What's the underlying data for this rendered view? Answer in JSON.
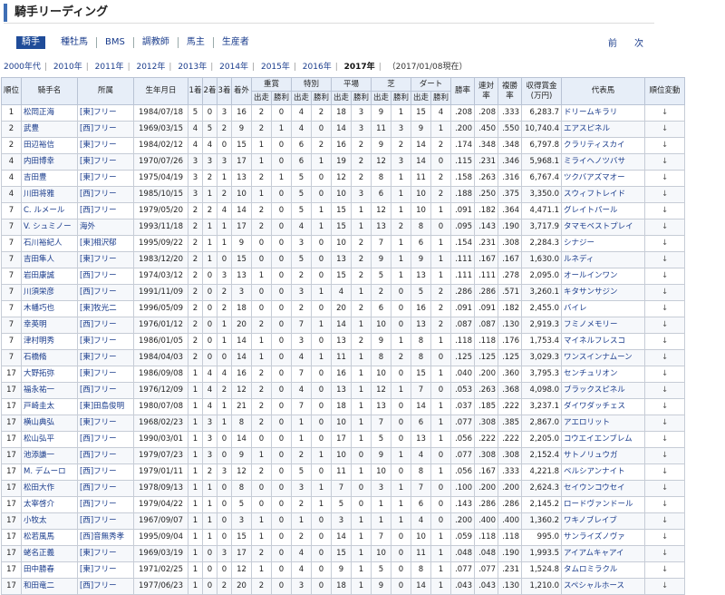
{
  "page_title": "騎手リーディング",
  "nav": {
    "active": "騎手",
    "items": [
      "種牡馬",
      "BMS",
      "調教師",
      "馬主",
      "生産者"
    ],
    "prev": "前",
    "next": "次"
  },
  "years": {
    "items": [
      "2000年代",
      "2010年",
      "2011年",
      "2012年",
      "2013年",
      "2014年",
      "2015年",
      "2016年"
    ],
    "current": "2017年",
    "current_note": "（2017/01/08現在）"
  },
  "table": {
    "headers_top": [
      "順位",
      "騎手名",
      "所属",
      "生年月日",
      "1着",
      "2着",
      "3着",
      "着外",
      "重賞",
      "特別",
      "平場",
      "芝",
      "ダート",
      "勝率",
      "連対率",
      "複勝率",
      "収得賞金(万円)",
      "代表馬",
      "順位変動"
    ],
    "headers_sub": [
      "出走",
      "勝利",
      "出走",
      "勝利",
      "出走",
      "勝利",
      "出走",
      "勝利",
      "出走",
      "勝利"
    ],
    "rows": [
      [
        "1",
        "松岡正海",
        "[東]フリー",
        "1984/07/18",
        "5",
        "0",
        "3",
        "16",
        "2",
        "0",
        "4",
        "2",
        "18",
        "3",
        "9",
        "1",
        "15",
        "4",
        ".208",
        ".208",
        ".333",
        "6,283.7",
        "ドリームキラリ",
        "↓"
      ],
      [
        "2",
        "武豊",
        "[西]フリー",
        "1969/03/15",
        "4",
        "5",
        "2",
        "9",
        "2",
        "1",
        "4",
        "0",
        "14",
        "3",
        "11",
        "3",
        "9",
        "1",
        ".200",
        ".450",
        ".550",
        "10,740.4",
        "エアスピネル",
        "↓"
      ],
      [
        "2",
        "田辺裕信",
        "[東]フリー",
        "1984/02/12",
        "4",
        "4",
        "0",
        "15",
        "1",
        "0",
        "6",
        "2",
        "16",
        "2",
        "9",
        "2",
        "14",
        "2",
        ".174",
        ".348",
        ".348",
        "6,797.8",
        "クラリティスカイ",
        "↓"
      ],
      [
        "4",
        "内田博幸",
        "[東]フリー",
        "1970/07/26",
        "3",
        "3",
        "3",
        "17",
        "1",
        "0",
        "6",
        "1",
        "19",
        "2",
        "12",
        "3",
        "14",
        "0",
        ".115",
        ".231",
        ".346",
        "5,968.1",
        "ミライヘノツバサ",
        "↓"
      ],
      [
        "4",
        "吉田豊",
        "[東]フリー",
        "1975/04/19",
        "3",
        "2",
        "1",
        "13",
        "2",
        "1",
        "5",
        "0",
        "12",
        "2",
        "8",
        "1",
        "11",
        "2",
        ".158",
        ".263",
        ".316",
        "6,767.4",
        "ツクバアズマオー",
        "↓"
      ],
      [
        "4",
        "川田将雅",
        "[西]フリー",
        "1985/10/15",
        "3",
        "1",
        "2",
        "10",
        "1",
        "0",
        "5",
        "0",
        "10",
        "3",
        "6",
        "1",
        "10",
        "2",
        ".188",
        ".250",
        ".375",
        "3,350.0",
        "スウィフトレイド",
        "↓"
      ],
      [
        "7",
        "C. ルメール",
        "[西]フリー",
        "1979/05/20",
        "2",
        "2",
        "4",
        "14",
        "2",
        "0",
        "5",
        "1",
        "15",
        "1",
        "12",
        "1",
        "10",
        "1",
        ".091",
        ".182",
        ".364",
        "4,471.1",
        "グレイトパール",
        "↓"
      ],
      [
        "7",
        "V. シュミノー",
        "海外",
        "1993/11/18",
        "2",
        "1",
        "1",
        "17",
        "2",
        "0",
        "4",
        "1",
        "15",
        "1",
        "13",
        "2",
        "8",
        "0",
        ".095",
        ".143",
        ".190",
        "3,717.9",
        "タマモベストプレイ",
        "↓"
      ],
      [
        "7",
        "石川裕紀人",
        "[東]相沢郁",
        "1995/09/22",
        "2",
        "1",
        "1",
        "9",
        "0",
        "0",
        "3",
        "0",
        "10",
        "2",
        "7",
        "1",
        "6",
        "1",
        ".154",
        ".231",
        ".308",
        "2,284.3",
        "シナジー",
        "↓"
      ],
      [
        "7",
        "吉田隼人",
        "[東]フリー",
        "1983/12/20",
        "2",
        "1",
        "0",
        "15",
        "0",
        "0",
        "5",
        "0",
        "13",
        "2",
        "9",
        "1",
        "9",
        "1",
        ".111",
        ".167",
        ".167",
        "1,630.0",
        "ルネディ",
        "↓"
      ],
      [
        "7",
        "岩田康誠",
        "[西]フリー",
        "1974/03/12",
        "2",
        "0",
        "3",
        "13",
        "1",
        "0",
        "2",
        "0",
        "15",
        "2",
        "5",
        "1",
        "13",
        "1",
        ".111",
        ".111",
        ".278",
        "2,095.0",
        "オールインワン",
        "↓"
      ],
      [
        "7",
        "川須栄彦",
        "[西]フリー",
        "1991/11/09",
        "2",
        "0",
        "2",
        "3",
        "0",
        "0",
        "3",
        "1",
        "4",
        "1",
        "2",
        "0",
        "5",
        "2",
        ".286",
        ".286",
        ".571",
        "3,260.1",
        "キタサンサジン",
        "↓"
      ],
      [
        "7",
        "木幡巧也",
        "[東]牧光二",
        "1996/05/09",
        "2",
        "0",
        "2",
        "18",
        "0",
        "0",
        "2",
        "0",
        "20",
        "2",
        "6",
        "0",
        "16",
        "2",
        ".091",
        ".091",
        ".182",
        "2,455.0",
        "バイレ",
        "↓"
      ],
      [
        "7",
        "幸英明",
        "[西]フリー",
        "1976/01/12",
        "2",
        "0",
        "1",
        "20",
        "2",
        "0",
        "7",
        "1",
        "14",
        "1",
        "10",
        "0",
        "13",
        "2",
        ".087",
        ".087",
        ".130",
        "2,919.3",
        "フミノメモリー",
        "↓"
      ],
      [
        "7",
        "津村明秀",
        "[東]フリー",
        "1986/01/05",
        "2",
        "0",
        "1",
        "14",
        "1",
        "0",
        "3",
        "0",
        "13",
        "2",
        "9",
        "1",
        "8",
        "1",
        ".118",
        ".118",
        ".176",
        "1,753.4",
        "マイネルフレスコ",
        "↓"
      ],
      [
        "7",
        "石橋脩",
        "[東]フリー",
        "1984/04/03",
        "2",
        "0",
        "0",
        "14",
        "1",
        "0",
        "4",
        "1",
        "11",
        "1",
        "8",
        "2",
        "8",
        "0",
        ".125",
        ".125",
        ".125",
        "3,029.3",
        "ワンスインナムーン",
        "↓"
      ],
      [
        "17",
        "大野拓弥",
        "[東]フリー",
        "1986/09/08",
        "1",
        "4",
        "4",
        "16",
        "2",
        "0",
        "7",
        "0",
        "16",
        "1",
        "10",
        "0",
        "15",
        "1",
        ".040",
        ".200",
        ".360",
        "3,795.3",
        "センチュリオン",
        "↓"
      ],
      [
        "17",
        "福永祐一",
        "[西]フリー",
        "1976/12/09",
        "1",
        "4",
        "2",
        "12",
        "2",
        "0",
        "4",
        "0",
        "13",
        "1",
        "12",
        "1",
        "7",
        "0",
        ".053",
        ".263",
        ".368",
        "4,098.0",
        "ブラックスピネル",
        "↓"
      ],
      [
        "17",
        "戸崎圭太",
        "[東]田島俊明",
        "1980/07/08",
        "1",
        "4",
        "1",
        "21",
        "2",
        "0",
        "7",
        "0",
        "18",
        "1",
        "13",
        "0",
        "14",
        "1",
        ".037",
        ".185",
        ".222",
        "3,237.1",
        "ダイワダッチェス",
        "↓"
      ],
      [
        "17",
        "横山典弘",
        "[東]フリー",
        "1968/02/23",
        "1",
        "3",
        "1",
        "8",
        "2",
        "0",
        "1",
        "0",
        "10",
        "1",
        "7",
        "0",
        "6",
        "1",
        ".077",
        ".308",
        ".385",
        "2,867.0",
        "アエロリット",
        "↓"
      ],
      [
        "17",
        "松山弘平",
        "[西]フリー",
        "1990/03/01",
        "1",
        "3",
        "0",
        "14",
        "0",
        "0",
        "1",
        "0",
        "17",
        "1",
        "5",
        "0",
        "13",
        "1",
        ".056",
        ".222",
        ".222",
        "2,205.0",
        "コウエイエンブレム",
        "↓"
      ],
      [
        "17",
        "池添謙一",
        "[西]フリー",
        "1979/07/23",
        "1",
        "3",
        "0",
        "9",
        "1",
        "0",
        "2",
        "1",
        "10",
        "0",
        "9",
        "1",
        "4",
        "0",
        ".077",
        ".308",
        ".308",
        "2,152.4",
        "サトノリュウガ",
        "↓"
      ],
      [
        "17",
        "M. デムーロ",
        "[西]フリー",
        "1979/01/11",
        "1",
        "2",
        "3",
        "12",
        "2",
        "0",
        "5",
        "0",
        "11",
        "1",
        "10",
        "0",
        "8",
        "1",
        ".056",
        ".167",
        ".333",
        "4,221.8",
        "ベルシアンナイト",
        "↓"
      ],
      [
        "17",
        "松田大作",
        "[西]フリー",
        "1978/09/13",
        "1",
        "1",
        "0",
        "8",
        "0",
        "0",
        "3",
        "1",
        "7",
        "0",
        "3",
        "1",
        "7",
        "0",
        ".100",
        ".200",
        ".200",
        "2,624.3",
        "セイウンコウセイ",
        "↓"
      ],
      [
        "17",
        "太宰啓介",
        "[西]フリー",
        "1979/04/22",
        "1",
        "1",
        "0",
        "5",
        "0",
        "0",
        "2",
        "1",
        "5",
        "0",
        "1",
        "1",
        "6",
        "0",
        ".143",
        ".286",
        ".286",
        "2,145.2",
        "ロードヴァンドール",
        "↓"
      ],
      [
        "17",
        "小牧太",
        "[西]フリー",
        "1967/09/07",
        "1",
        "1",
        "0",
        "3",
        "1",
        "0",
        "1",
        "0",
        "3",
        "1",
        "1",
        "1",
        "4",
        "0",
        ".200",
        ".400",
        ".400",
        "1,360.2",
        "ワキノブレイブ",
        "↓"
      ],
      [
        "17",
        "松若風馬",
        "[西]音無秀孝",
        "1995/09/04",
        "1",
        "1",
        "0",
        "15",
        "1",
        "0",
        "2",
        "0",
        "14",
        "1",
        "7",
        "0",
        "10",
        "1",
        ".059",
        ".118",
        ".118",
        "995.0",
        "サンライズノヴァ",
        "↓"
      ],
      [
        "17",
        "蛯名正義",
        "[東]フリー",
        "1969/03/19",
        "1",
        "0",
        "3",
        "17",
        "2",
        "0",
        "4",
        "0",
        "15",
        "1",
        "10",
        "0",
        "11",
        "1",
        ".048",
        ".048",
        ".190",
        "1,993.5",
        "アイアムキャアイ",
        "↓"
      ],
      [
        "17",
        "田中勝春",
        "[東]フリー",
        "1971/02/25",
        "1",
        "0",
        "0",
        "12",
        "1",
        "0",
        "4",
        "0",
        "9",
        "1",
        "5",
        "0",
        "8",
        "1",
        ".077",
        ".077",
        ".231",
        "1,524.8",
        "タムロミラクル",
        "↓"
      ],
      [
        "17",
        "和田竜二",
        "[西]フリー",
        "1977/06/23",
        "1",
        "0",
        "2",
        "20",
        "2",
        "0",
        "3",
        "0",
        "18",
        "1",
        "9",
        "0",
        "14",
        "1",
        ".043",
        ".043",
        ".130",
        "1,210.0",
        "スペシャルホース",
        "↓"
      ]
    ]
  }
}
